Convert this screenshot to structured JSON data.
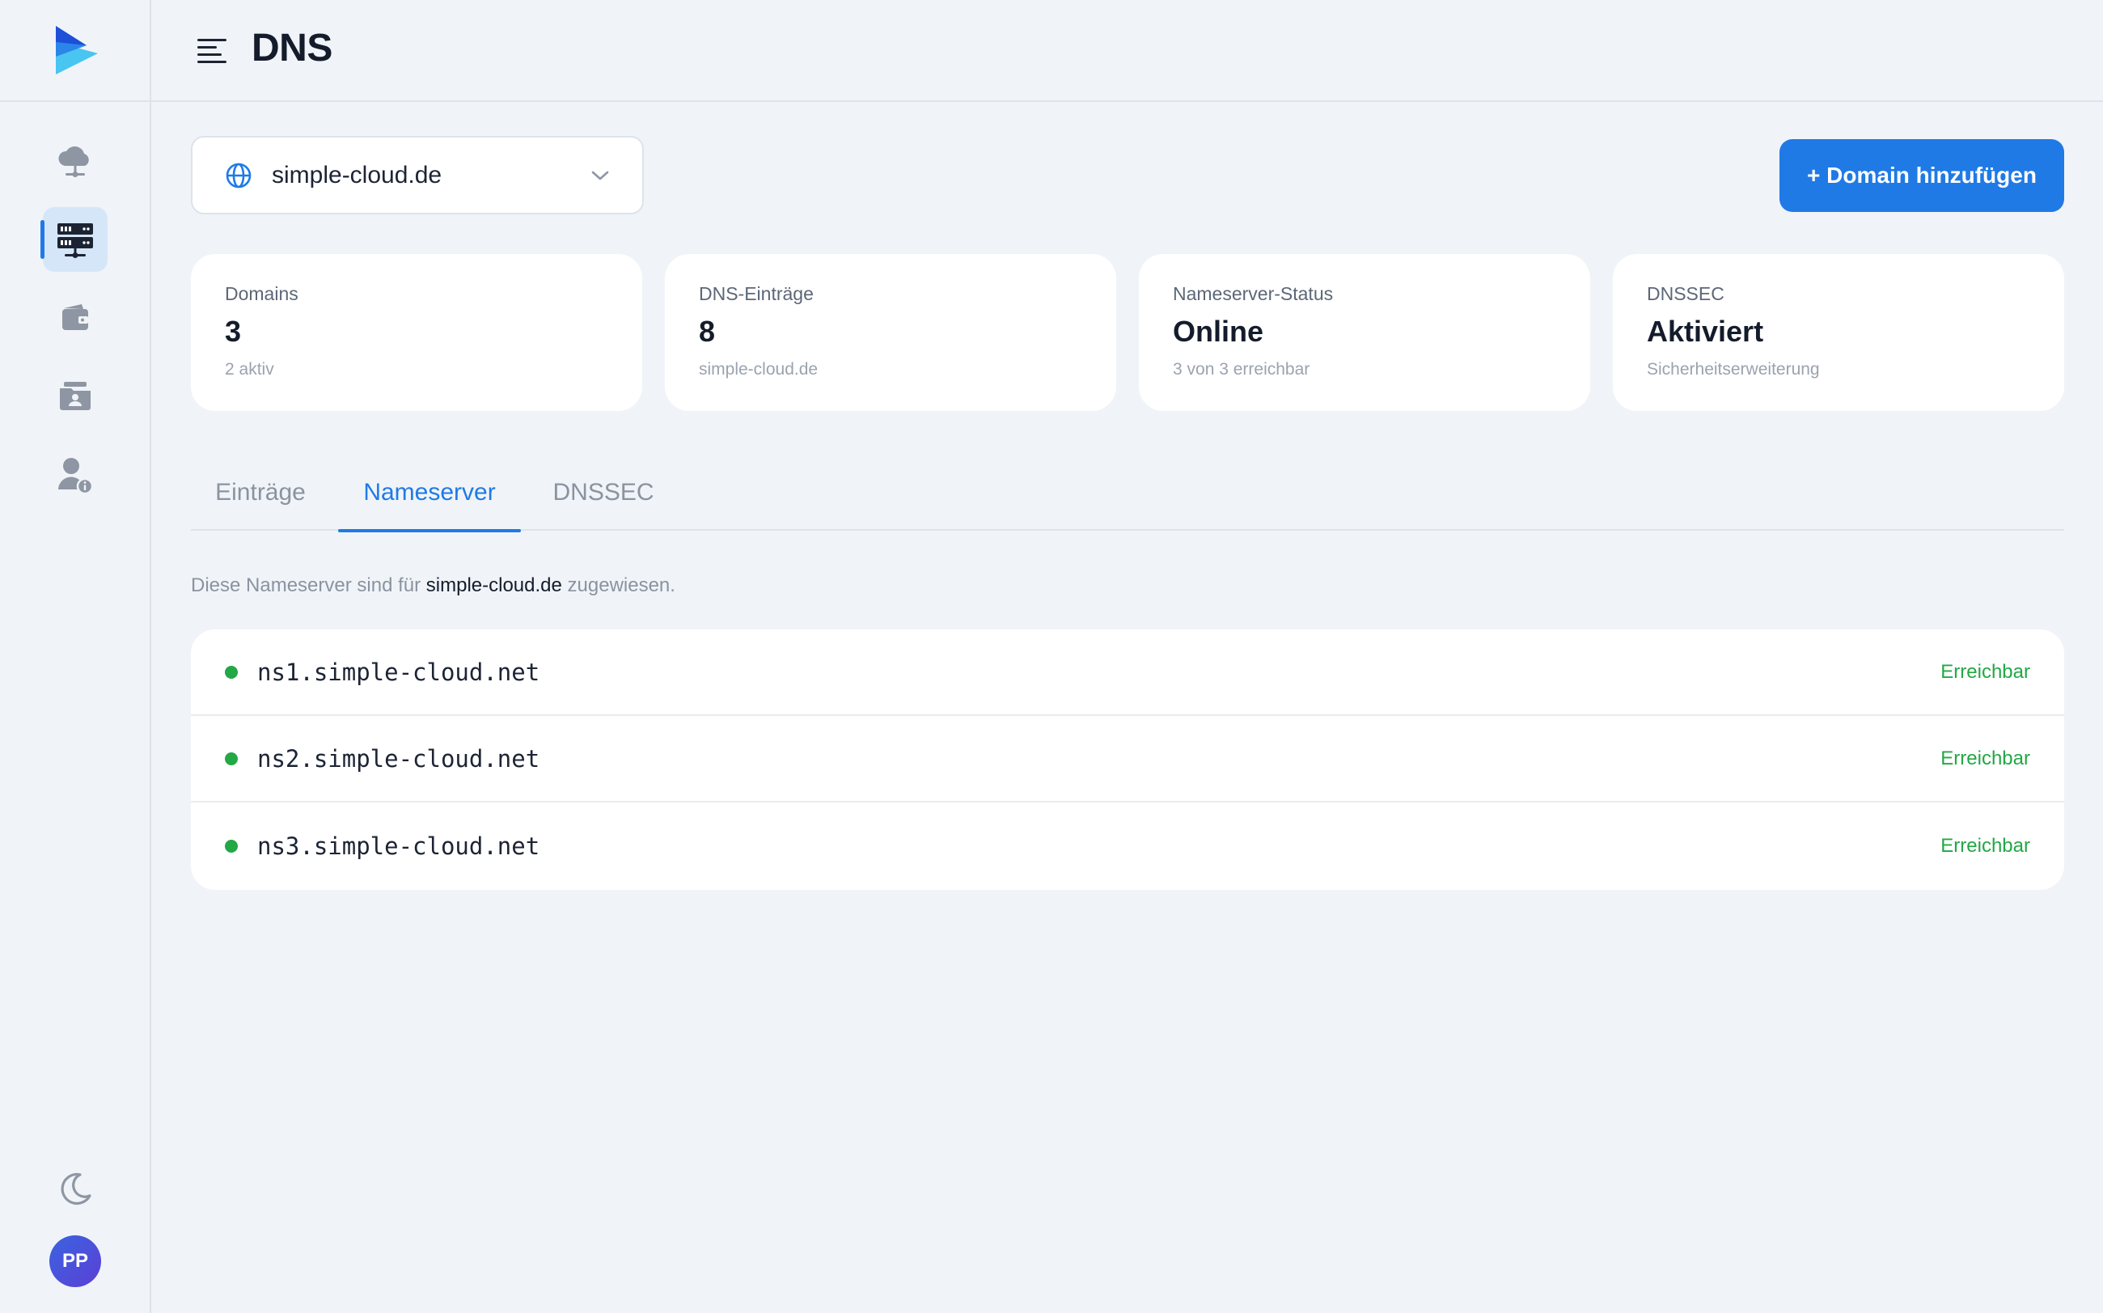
{
  "header": {
    "title": "DNS"
  },
  "sidebar": {
    "items": [
      {
        "icon": "cloud-server-icon",
        "active": false
      },
      {
        "icon": "dns-server-icon",
        "active": true
      },
      {
        "icon": "wallet-icon",
        "active": false
      },
      {
        "icon": "folder-user-icon",
        "active": false
      },
      {
        "icon": "user-info-icon",
        "active": false
      }
    ],
    "theme_icon": "moon-icon",
    "avatar_initials": "PP"
  },
  "domain_select": {
    "value": "simple-cloud.de",
    "icon": "globe-icon"
  },
  "add_button": {
    "label": "+ Domain hinzufügen"
  },
  "stats": [
    {
      "label": "Domains",
      "value": "3",
      "sub": "2 aktiv"
    },
    {
      "label": "DNS-Einträge",
      "value": "8",
      "sub": "simple-cloud.de"
    },
    {
      "label": "Nameserver-Status",
      "value": "Online",
      "sub": "3 von 3 erreichbar"
    },
    {
      "label": "DNSSEC",
      "value": "Aktiviert",
      "sub": "Sicherheitserweiterung"
    }
  ],
  "tabs": [
    {
      "label": "Einträge",
      "active": false
    },
    {
      "label": "Nameserver",
      "active": true
    },
    {
      "label": "DNSSEC",
      "active": false
    }
  ],
  "description": {
    "prefix": "Diese Nameserver sind für ",
    "domain": "simple-cloud.de",
    "suffix": " zugewiesen."
  },
  "nameservers": [
    {
      "name": "ns1.simple-cloud.net",
      "status": "Erreichbar"
    },
    {
      "name": "ns2.simple-cloud.net",
      "status": "Erreichbar"
    },
    {
      "name": "ns3.simple-cloud.net",
      "status": "Erreichbar"
    }
  ],
  "colors": {
    "accent": "#1f7ae6",
    "success": "#22a845",
    "background": "#f0f4f8"
  }
}
